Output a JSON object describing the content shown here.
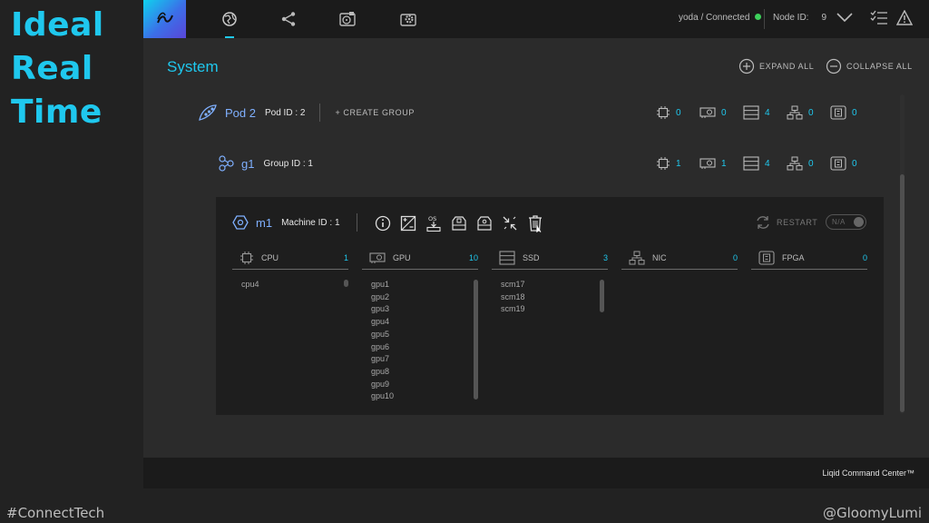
{
  "slide": {
    "title_lines": [
      "Ideal",
      "Real",
      "Time"
    ],
    "hashtag": "#ConnectTech",
    "handle": "@GloomyLumi"
  },
  "topbar": {
    "nav": [
      "logo-icon",
      "globe-icon",
      "share-icon",
      "hard-disk-icon",
      "gear-box-icon"
    ],
    "connection_text": "yoda / Connected",
    "connection_color": "#3dd15b",
    "node_label": "Node ID:",
    "node_value": "9"
  },
  "system": {
    "title": "System",
    "expand_all": "EXPAND ALL",
    "collapse_all": "COLLAPSE ALL"
  },
  "pod": {
    "name": "Pod 2",
    "id_text": "Pod ID : 2",
    "create_group": "+ CREATE GROUP",
    "counts": {
      "cpu": "0",
      "gpu": "0",
      "ssd": "4",
      "nic": "0",
      "fpga": "0"
    }
  },
  "group": {
    "name": "g1",
    "id_text": "Group ID : 1",
    "counts": {
      "cpu": "1",
      "gpu": "1",
      "ssd": "4",
      "nic": "0",
      "fpga": "0"
    }
  },
  "machine": {
    "name": "m1",
    "id_text": "Machine ID : 1",
    "restart": "RESTART",
    "toggle_label": "N/A",
    "resources": [
      {
        "label": "CPU",
        "count": "1",
        "items": [
          "cpu4"
        ]
      },
      {
        "label": "GPU",
        "count": "10",
        "items": [
          "gpu1",
          "gpu2",
          "gpu3",
          "gpu4",
          "gpu5",
          "gpu6",
          "gpu7",
          "gpu8",
          "gpu9",
          "gpu10"
        ]
      },
      {
        "label": "SSD",
        "count": "3",
        "items": [
          "scm17",
          "scm18",
          "scm19"
        ]
      },
      {
        "label": "NIC",
        "count": "0",
        "items": []
      },
      {
        "label": "FPGA",
        "count": "0",
        "items": []
      }
    ]
  },
  "footer": {
    "text": "Liqid Command Center™"
  },
  "colors": {
    "accent": "#1fc8ee",
    "entity_name": "#7fb0ff"
  }
}
